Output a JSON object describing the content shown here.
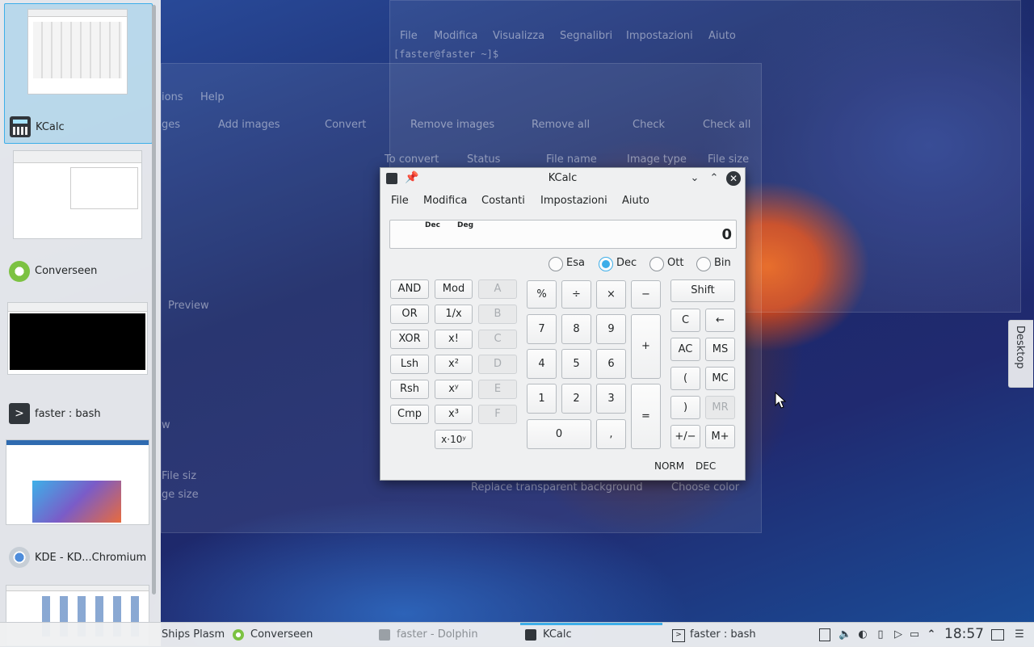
{
  "background_windows": {
    "terminal": {
      "menu": [
        "File",
        "Modifica",
        "Visualizza",
        "Segnalibri",
        "Impostazioni",
        "Aiuto"
      ],
      "prompt": "[faster@faster ~]$ "
    },
    "converseen": {
      "menu_partial": [
        "ions",
        "Help"
      ],
      "toolbar": [
        "ges",
        "Add images",
        "Convert",
        "Remove images",
        "Remove all",
        "Check",
        "Check all"
      ],
      "columns": [
        "To convert",
        "Status",
        "File name",
        "Image type",
        "File size"
      ],
      "preview_label": "Preview",
      "options": [
        "Replace transparent background",
        "Choose color"
      ],
      "side_partial": [
        "w",
        "File siz",
        "ge size"
      ]
    }
  },
  "switcher": {
    "items": [
      {
        "label": "KCalc",
        "icon": "calculator-icon"
      },
      {
        "label": "Converseen",
        "icon": "converseen-icon"
      },
      {
        "label": "faster : bash",
        "icon": "terminal-icon"
      },
      {
        "label": "KDE - KD...Chromium",
        "icon": "chromium-icon"
      }
    ]
  },
  "kcalc": {
    "title": "KCalc",
    "menu": [
      "File",
      "Modifica",
      "Costanti",
      "Impostazioni",
      "Aiuto"
    ],
    "display": {
      "flag1": "Dec",
      "flag2": "Deg",
      "value": "0"
    },
    "bases": [
      {
        "label": "Esa",
        "checked": false
      },
      {
        "label": "Dec",
        "checked": true
      },
      {
        "label": "Ott",
        "checked": false
      },
      {
        "label": "Bin",
        "checked": false
      }
    ],
    "logic_buttons": [
      "AND",
      "OR",
      "XOR",
      "Lsh",
      "Rsh",
      "Cmp"
    ],
    "func_buttons": [
      "Mod",
      "1/x",
      "x!",
      "x²",
      "xʸ",
      "x³",
      "x·10ʸ"
    ],
    "hex_buttons": [
      "A",
      "B",
      "C",
      "D",
      "E",
      "F"
    ],
    "op_buttons": [
      "%",
      "÷",
      "×",
      "−"
    ],
    "digits": [
      "7",
      "8",
      "9",
      "4",
      "5",
      "6",
      "1",
      "2",
      "3",
      "0",
      ","
    ],
    "plus": "+",
    "equals": "=",
    "right_buttons": {
      "shift": "Shift",
      "clear": "C",
      "backspace": "←",
      "all_clear": "AC",
      "ms": "MS",
      "open_paren": "(",
      "mc": "MC",
      "close_paren": ")",
      "mr": "MR",
      "plusminus": "+/−",
      "mplus": "M+"
    },
    "status": {
      "norm": "NORM",
      "base": "DEC"
    }
  },
  "desktop_tab": "Desktop",
  "taskbar": {
    "tasks": [
      {
        "label": "Ships Plasm",
        "icon": "plasma-icon"
      },
      {
        "label": "Converseen",
        "icon": "converseen-icon"
      },
      {
        "label": "faster - Dolphin",
        "icon": "folder-icon"
      },
      {
        "label": "KCalc",
        "icon": "calculator-icon",
        "active": true
      },
      {
        "label": "faster : bash",
        "icon": "terminal-icon"
      }
    ],
    "clock": "18:57"
  },
  "colors": {
    "accent": "#3daee9",
    "panel": "#eff0f1"
  }
}
